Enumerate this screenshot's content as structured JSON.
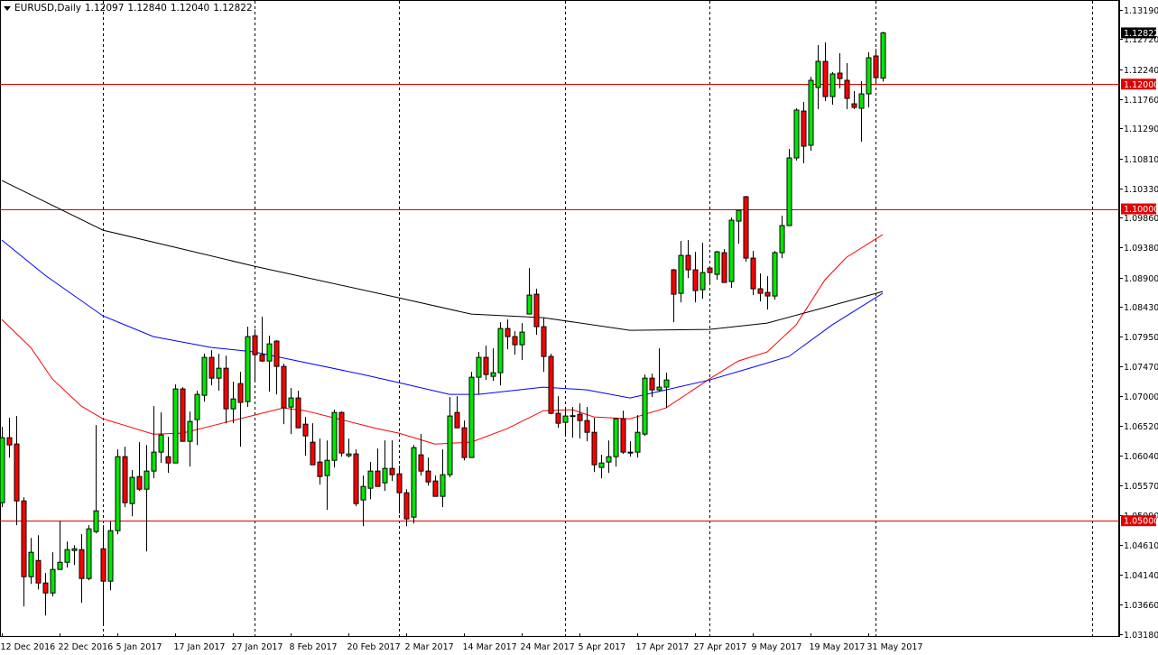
{
  "header": {
    "symbol_timeframe": "EURUSD,Daily",
    "open": "1.12097",
    "high": "1.12840",
    "low": "1.12040",
    "close": "1.12822",
    "menu_icon": "triangle-down-icon"
  },
  "colors": {
    "bull": "#00e800",
    "bear": "#ff0000",
    "ma_fast": "#ff0000",
    "ma_mid": "#0000ff",
    "ma_slow": "#000000",
    "level_line": "#e00000",
    "grid": "#000000"
  },
  "chart_data": {
    "type": "candlestick",
    "title": "EURUSD,Daily",
    "ylim": [
      1.0318,
      1.1319
    ],
    "grid": false,
    "y_ticks": [
      "1.13190",
      "1.12720",
      "1.12240",
      "1.11760",
      "1.11290",
      "1.10810",
      "1.10330",
      "1.09860",
      "1.09380",
      "1.08900",
      "1.08430",
      "1.07950",
      "1.07470",
      "1.07000",
      "1.06520",
      "1.06040",
      "1.05570",
      "1.05090",
      "1.04610",
      "1.04140",
      "1.03660",
      "1.03180"
    ],
    "x_labels": [
      {
        "index": 0,
        "label": "12 Dec 2016"
      },
      {
        "index": 8,
        "label": "22 Dec 2016"
      },
      {
        "index": 16,
        "label": "5 Jan 2017"
      },
      {
        "index": 24,
        "label": "17 Jan 2017"
      },
      {
        "index": 32,
        "label": "27 Jan 2017"
      },
      {
        "index": 40,
        "label": "8 Feb 2017"
      },
      {
        "index": 48,
        "label": "20 Feb 2017"
      },
      {
        "index": 56,
        "label": "2 Mar 2017"
      },
      {
        "index": 64,
        "label": "14 Mar 2017"
      },
      {
        "index": 72,
        "label": "24 Mar 2017"
      },
      {
        "index": 80,
        "label": "5 Apr 2017"
      },
      {
        "index": 88,
        "label": "17 Apr 2017"
      },
      {
        "index": 96,
        "label": "27 Apr 2017"
      },
      {
        "index": 104,
        "label": "9 May 2017"
      },
      {
        "index": 112,
        "label": "19 May 2017"
      },
      {
        "index": 120,
        "label": "31 May 2017"
      }
    ],
    "period_separators": [
      14,
      35,
      55,
      78,
      98,
      121,
      151
    ],
    "levels": [
      {
        "value": 1.12,
        "label": "1.12000"
      },
      {
        "value": 1.1,
        "label": "1.10000"
      },
      {
        "value": 1.05,
        "label": "1.05000"
      }
    ],
    "last_price": {
      "value": 1.12822,
      "label": "1.12822"
    },
    "ohlc": [
      [
        1.05289,
        1.06505,
        1.05217,
        1.06331
      ],
      [
        1.06331,
        1.0665,
        1.06013,
        1.06215
      ],
      [
        1.0623,
        1.06679,
        1.04928,
        1.05318
      ],
      [
        1.05318,
        1.05376,
        1.03625,
        1.04103
      ],
      [
        1.04103,
        1.04725,
        1.03987,
        1.04494
      ],
      [
        1.04363,
        1.04768,
        1.039,
        1.04002
      ],
      [
        1.04002,
        1.04161,
        1.03481,
        1.03842
      ],
      [
        1.03842,
        1.04494,
        1.03785,
        1.04219
      ],
      [
        1.04219,
        1.05,
        1.04219,
        1.04334
      ],
      [
        1.04334,
        1.04667,
        1.04248,
        1.04537
      ],
      [
        1.04522,
        1.04609,
        1.04291,
        1.04551
      ],
      [
        1.04537,
        1.04783,
        1.03683,
        1.04074
      ],
      [
        1.04074,
        1.04928,
        1.04045,
        1.0487
      ],
      [
        1.04826,
        1.06534,
        1.04797,
        1.05159
      ],
      [
        1.04551,
        1.04928,
        1.03321,
        1.04031
      ],
      [
        1.04031,
        1.04986,
        1.03886,
        1.04841
      ],
      [
        1.04841,
        1.06143,
        1.04783,
        1.06027
      ],
      [
        1.06027,
        1.06187,
        1.05217,
        1.05289
      ],
      [
        1.05275,
        1.0581,
        1.05072,
        1.05695
      ],
      [
        1.05709,
        1.06259,
        1.05478,
        1.05506
      ],
      [
        1.05506,
        1.06215,
        1.04508,
        1.05796
      ],
      [
        1.05796,
        1.06838,
        1.0568,
        1.061
      ],
      [
        1.061,
        1.06736,
        1.05926,
        1.06375
      ],
      [
        1.06027,
        1.06346,
        1.05767,
        1.05926
      ],
      [
        1.05926,
        1.07185,
        1.05926,
        1.07113
      ],
      [
        1.07113,
        1.07142,
        1.06273,
        1.06273
      ],
      [
        1.06273,
        1.06751,
        1.05868,
        1.06592
      ],
      [
        1.06621,
        1.07084,
        1.06215,
        1.07026
      ],
      [
        1.07011,
        1.07677,
        1.0691,
        1.07619
      ],
      [
        1.07619,
        1.07735,
        1.07171,
        1.07286
      ],
      [
        1.07286,
        1.07677,
        1.07084,
        1.07445
      ],
      [
        1.07445,
        1.07648,
        1.06563,
        1.06794
      ],
      [
        1.06794,
        1.07228,
        1.06563,
        1.06953
      ],
      [
        1.07199,
        1.07388,
        1.06187,
        1.06896
      ],
      [
        1.0691,
        1.08111,
        1.06823,
        1.07952
      ],
      [
        1.07966,
        1.08068,
        1.07243,
        1.07662
      ],
      [
        1.07662,
        1.0827,
        1.07547,
        1.07561
      ],
      [
        1.07561,
        1.07966,
        1.07069,
        1.07836
      ],
      [
        1.0788,
        1.07894,
        1.07026,
        1.07474
      ],
      [
        1.07474,
        1.07518,
        1.06548,
        1.06809
      ],
      [
        1.06823,
        1.07127,
        1.06389,
        1.06968
      ],
      [
        1.06968,
        1.07084,
        1.0649,
        1.0649
      ],
      [
        1.06548,
        1.06664,
        1.06042,
        1.0636
      ],
      [
        1.06259,
        1.06563,
        1.05897,
        1.05897
      ],
      [
        1.05941,
        1.06317,
        1.05579,
        1.05709
      ],
      [
        1.05724,
        1.06288,
        1.05174,
        1.05969
      ],
      [
        1.05969,
        1.0678,
        1.05854,
        1.06736
      ],
      [
        1.06736,
        1.06751,
        1.06027,
        1.06085
      ],
      [
        1.06042,
        1.06317,
        1.06013,
        1.06071
      ],
      [
        1.06071,
        1.06143,
        1.05232,
        1.05275
      ],
      [
        1.05333,
        1.05724,
        1.04913,
        1.0555
      ],
      [
        1.05521,
        1.05941,
        1.05347,
        1.05796
      ],
      [
        1.05796,
        1.06158,
        1.0555,
        1.0555
      ],
      [
        1.05608,
        1.06288,
        1.05478,
        1.05839
      ],
      [
        1.05839,
        1.06288,
        1.05637,
        1.05738
      ],
      [
        1.05752,
        1.05883,
        1.05116,
        1.05449
      ],
      [
        1.05449,
        1.05506,
        1.04913,
        1.05029
      ],
      [
        1.05058,
        1.06215,
        1.04957,
        1.06172
      ],
      [
        1.06056,
        1.06389,
        1.05724,
        1.05796
      ],
      [
        1.05796,
        1.06013,
        1.05564,
        1.05622
      ],
      [
        1.05637,
        1.05724,
        1.05391,
        1.05391
      ],
      [
        1.05391,
        1.06143,
        1.05217,
        1.05738
      ],
      [
        1.05738,
        1.06982,
        1.05695,
        1.06679
      ],
      [
        1.06736,
        1.06997,
        1.0649,
        1.0649
      ],
      [
        1.0649,
        1.06606,
        1.05969,
        1.06013
      ],
      [
        1.06013,
        1.07388,
        1.06013,
        1.07301
      ],
      [
        1.07301,
        1.07706,
        1.07026,
        1.07619
      ],
      [
        1.07619,
        1.07807,
        1.07257,
        1.07344
      ],
      [
        1.07315,
        1.07764,
        1.07243,
        1.07373
      ],
      [
        1.07373,
        1.08183,
        1.07171,
        1.08082
      ],
      [
        1.08082,
        1.08227,
        1.07749,
        1.07952
      ],
      [
        1.07952,
        1.08039,
        1.07662,
        1.07822
      ],
      [
        1.07822,
        1.08169,
        1.07576,
        1.08024
      ],
      [
        1.08314,
        1.09052,
        1.08314,
        1.08618
      ],
      [
        1.08632,
        1.08719,
        1.07981,
        1.08111
      ],
      [
        1.08111,
        1.08256,
        1.07388,
        1.07634
      ],
      [
        1.07634,
        1.07677,
        1.06707,
        1.06722
      ],
      [
        1.06722,
        1.06997,
        1.0649,
        1.06563
      ],
      [
        1.06577,
        1.06809,
        1.06375,
        1.06679
      ],
      [
        1.06685,
        1.06823,
        1.06331,
        1.0668
      ],
      [
        1.06707,
        1.06881,
        1.06317,
        1.06606
      ],
      [
        1.06606,
        1.06823,
        1.06273,
        1.06418
      ],
      [
        1.06418,
        1.0665,
        1.05781,
        1.05897
      ],
      [
        1.05854,
        1.06056,
        1.0568,
        1.05926
      ],
      [
        1.05941,
        1.06288,
        1.05767,
        1.06027
      ],
      [
        1.06027,
        1.0665,
        1.05868,
        1.06635
      ],
      [
        1.06635,
        1.06765,
        1.06071,
        1.061
      ],
      [
        1.061,
        1.06273,
        1.06027,
        1.06085
      ],
      [
        1.061,
        1.06693,
        1.06013,
        1.06418
      ],
      [
        1.06389,
        1.07344,
        1.0636,
        1.07286
      ],
      [
        1.07286,
        1.07359,
        1.06982,
        1.07098
      ],
      [
        1.07098,
        1.07764,
        1.07069,
        1.07142
      ],
      [
        1.07142,
        1.07373,
        1.06809,
        1.07257
      ],
      [
        1.09023,
        1.09037,
        1.08183,
        1.08632
      ],
      [
        1.08646,
        1.09486,
        1.08502,
        1.09254
      ],
      [
        1.09254,
        1.095,
        1.08892,
        1.09023
      ],
      [
        1.09023,
        1.09312,
        1.08502,
        1.0869
      ],
      [
        1.08704,
        1.09457,
        1.0856,
        1.08979
      ],
      [
        1.09052,
        1.09052,
        1.0882,
        1.08979
      ],
      [
        1.0895,
        1.09326,
        1.08863,
        1.09312
      ],
      [
        1.09298,
        1.09355,
        1.0882,
        1.0882
      ],
      [
        1.08835,
        1.09862,
        1.08733,
        1.09819
      ],
      [
        1.09804,
        1.09978,
        1.09442,
        1.09978
      ],
      [
        1.10195,
        1.10209,
        1.09153,
        1.09211
      ],
      [
        1.09211,
        1.09326,
        1.08618,
        1.08719
      ],
      [
        1.08719,
        1.08965,
        1.08516,
        1.08646
      ],
      [
        1.08661,
        1.08921,
        1.08386,
        1.08603
      ],
      [
        1.08603,
        1.09326,
        1.08545,
        1.09298
      ],
      [
        1.09298,
        1.09891,
        1.09211,
        1.09732
      ],
      [
        1.09732,
        1.10962,
        1.09732,
        1.10817
      ],
      [
        1.10817,
        1.11613,
        1.10774,
        1.11584
      ],
      [
        1.11569,
        1.11714,
        1.1073,
        1.11005
      ],
      [
        1.1102,
        1.12119,
        1.10933,
        1.12061
      ],
      [
        1.11946,
        1.12626,
        1.11598,
        1.12365
      ],
      [
        1.12365,
        1.12669,
        1.11729,
        1.11801
      ],
      [
        1.11801,
        1.12192,
        1.11671,
        1.12163
      ],
      [
        1.12177,
        1.12495,
        1.11931,
        1.1209
      ],
      [
        1.12061,
        1.12336,
        1.11598,
        1.11772
      ],
      [
        1.11685,
        1.11888,
        1.11598,
        1.11627
      ],
      [
        1.11613,
        1.12047,
        1.11077,
        1.11844
      ],
      [
        1.11844,
        1.1251,
        1.11627,
        1.12423
      ],
      [
        1.12452,
        1.12568,
        1.12018,
        1.12105
      ],
      [
        1.12097,
        1.1284,
        1.1204,
        1.12822
      ]
    ],
    "moving_averages": [
      {
        "name": "ma-fast",
        "color": "#ff0000",
        "points": [
          [
            0,
            1.08227
          ],
          [
            4,
            1.07778
          ],
          [
            7,
            1.07272
          ],
          [
            11,
            1.06838
          ],
          [
            14,
            1.06635
          ],
          [
            21,
            1.06389
          ],
          [
            25,
            1.06404
          ],
          [
            30,
            1.06548
          ],
          [
            35,
            1.06693
          ],
          [
            39,
            1.06809
          ],
          [
            42,
            1.06765
          ],
          [
            47,
            1.06621
          ],
          [
            52,
            1.06476
          ],
          [
            55,
            1.06404
          ],
          [
            60,
            1.0623
          ],
          [
            65,
            1.06259
          ],
          [
            70,
            1.06476
          ],
          [
            75,
            1.06765
          ],
          [
            79,
            1.0678
          ],
          [
            82,
            1.06664
          ],
          [
            87,
            1.06635
          ],
          [
            92,
            1.06809
          ],
          [
            98,
            1.07272
          ],
          [
            102,
            1.07561
          ],
          [
            106,
            1.07706
          ],
          [
            110,
            1.0814
          ],
          [
            114,
            1.08863
          ],
          [
            117,
            1.09225
          ],
          [
            122,
            1.09587
          ]
        ]
      },
      {
        "name": "ma-mid",
        "color": "#0000ff",
        "points": [
          [
            0,
            1.095
          ],
          [
            6,
            1.08936
          ],
          [
            14,
            1.08285
          ],
          [
            21,
            1.07952
          ],
          [
            29,
            1.07778
          ],
          [
            35,
            1.07706
          ],
          [
            41,
            1.07561
          ],
          [
            50,
            1.07344
          ],
          [
            55,
            1.07214
          ],
          [
            62,
            1.07026
          ],
          [
            66,
            1.07026
          ],
          [
            75,
            1.07142
          ],
          [
            81,
            1.07098
          ],
          [
            87,
            1.06968
          ],
          [
            92,
            1.07098
          ],
          [
            98,
            1.07257
          ],
          [
            104,
            1.0746
          ],
          [
            109,
            1.07634
          ],
          [
            115,
            1.0814
          ],
          [
            122,
            1.08646
          ]
        ]
      },
      {
        "name": "ma-slow",
        "color": "#000000",
        "points": [
          [
            0,
            1.10455
          ],
          [
            14,
            1.09659
          ],
          [
            35,
            1.09081
          ],
          [
            55,
            1.08574
          ],
          [
            65,
            1.08314
          ],
          [
            75,
            1.08256
          ],
          [
            87,
            1.08053
          ],
          [
            98,
            1.08068
          ],
          [
            106,
            1.08169
          ],
          [
            112,
            1.08357
          ],
          [
            122,
            1.08675
          ]
        ]
      }
    ]
  }
}
